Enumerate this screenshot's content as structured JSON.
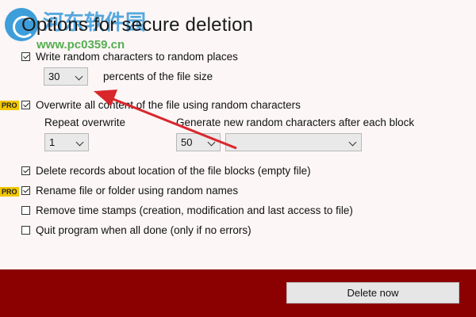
{
  "watermark": {
    "name": "河东软件园",
    "url": "www.pc0359.cn"
  },
  "header": {
    "title": "Options for secure deletion"
  },
  "options": {
    "write_random": {
      "label": "Write random characters to random places",
      "checked": true
    },
    "percent": {
      "value": "30",
      "suffix": "percents of the file size"
    },
    "overwrite_all": {
      "label": "Overwrite all content of the file using random characters",
      "checked": true,
      "badge": "PRO"
    },
    "repeat_overwrite": {
      "label": "Repeat overwrite",
      "value": "1"
    },
    "generate_chars": {
      "label": "Generate new random characters after each block",
      "value": "50",
      "unit_value": ""
    },
    "delete_records": {
      "label": "Delete records about location of the file blocks (empty file)",
      "checked": true
    },
    "rename_file": {
      "label": "Rename file or folder using random names",
      "checked": true,
      "badge": "PRO"
    },
    "remove_timestamps": {
      "label": "Remove time stamps (creation, modification and last access to file)",
      "checked": false
    },
    "quit_program": {
      "label": "Quit program when all done (only if no errors)",
      "checked": false
    }
  },
  "footer": {
    "delete_button": "Delete now"
  },
  "colors": {
    "footer_bg": "#8b0000",
    "pro_badge": "#f2c600",
    "annotation_arrow": "#d9262b"
  }
}
